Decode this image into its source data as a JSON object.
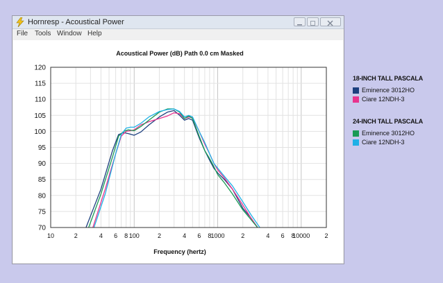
{
  "window": {
    "title": "Hornresp - Acoustical Power",
    "menu": [
      "File",
      "Tools",
      "Window",
      "Help"
    ]
  },
  "chart_data": {
    "type": "line",
    "title": "Acoustical Power (dB)   Path 0.0 cm   Masked",
    "xlabel": "Frequency (hertz)",
    "ylabel": "",
    "x_scale": "log",
    "xlim": [
      10,
      20000
    ],
    "ylim": [
      70,
      120
    ],
    "grid": true,
    "y_ticks": [
      70,
      75,
      80,
      85,
      90,
      95,
      100,
      105,
      110,
      115,
      120
    ],
    "x_tick_labels": [
      {
        "x": 10,
        "label": "10"
      },
      {
        "x": 20,
        "label": "2"
      },
      {
        "x": 40,
        "label": "4"
      },
      {
        "x": 60,
        "label": "6"
      },
      {
        "x": 80,
        "label": "8"
      },
      {
        "x": 100,
        "label": "100"
      },
      {
        "x": 200,
        "label": "2"
      },
      {
        "x": 400,
        "label": "4"
      },
      {
        "x": 600,
        "label": "6"
      },
      {
        "x": 800,
        "label": "8"
      },
      {
        "x": 1000,
        "label": "1000"
      },
      {
        "x": 2000,
        "label": "2"
      },
      {
        "x": 4000,
        "label": "4"
      },
      {
        "x": 6000,
        "label": "6"
      },
      {
        "x": 8000,
        "label": "8"
      },
      {
        "x": 10000,
        "label": "10000"
      },
      {
        "x": 20000,
        "label": "2"
      }
    ],
    "series": [
      {
        "name": "Eminence 3012HO",
        "group": "18-INCH TALL PASCALA",
        "color": "#1c3f7e",
        "x": [
          26.5,
          40,
          55,
          65,
          75,
          85,
          100,
          120,
          150,
          200,
          250,
          300,
          350,
          400,
          450,
          500,
          600,
          700,
          800,
          900,
          1000,
          1200,
          1500,
          2000,
          2500,
          3000
        ],
        "y": [
          70,
          82,
          94,
          99,
          99.6,
          99.3,
          98.8,
          99.8,
          102,
          104.5,
          106,
          106.5,
          105,
          103.5,
          104,
          103.5,
          98,
          94,
          91,
          88.5,
          87,
          85,
          82,
          76,
          73,
          70
        ]
      },
      {
        "name": "Ciare 12NDH-3",
        "group": "18-INCH TALL PASCALA",
        "color": "#e8338e",
        "x": [
          32,
          45,
          60,
          70,
          80,
          90,
          100,
          120,
          150,
          200,
          250,
          300,
          350,
          400,
          450,
          500,
          600,
          700,
          800,
          900,
          1000,
          1200,
          1500,
          2000,
          2500,
          3000
        ],
        "y": [
          70,
          82,
          93,
          98.5,
          100,
          100.2,
          100.5,
          102,
          103,
          104,
          104.8,
          105.8,
          105.5,
          104,
          104.5,
          104.2,
          100,
          96,
          93,
          90,
          88,
          85.5,
          82,
          77,
          73,
          70
        ]
      },
      {
        "name": "Eminence 3012HO",
        "group": "24-INCH TALL PASCALA",
        "color": "#1a9a55",
        "x": [
          28.5,
          40,
          55,
          65,
          75,
          85,
          100,
          120,
          150,
          200,
          250,
          300,
          350,
          400,
          450,
          500,
          600,
          700,
          800,
          900,
          1000,
          1200,
          1500,
          2000,
          2500,
          3000
        ],
        "y": [
          70,
          80.5,
          92,
          98.5,
          100,
          100.5,
          100.2,
          101.5,
          103.5,
          106,
          107,
          107,
          106,
          104,
          104.8,
          104,
          98.5,
          94,
          91.5,
          89,
          86.5,
          84,
          80.5,
          75.5,
          72.5,
          70
        ]
      },
      {
        "name": "Ciare 12NDH-3",
        "group": "24-INCH TALL PASCALA",
        "color": "#1fb0e6",
        "x": [
          33,
          45,
          60,
          70,
          80,
          90,
          100,
          120,
          150,
          200,
          250,
          300,
          350,
          400,
          450,
          500,
          600,
          700,
          800,
          900,
          1000,
          1200,
          1500,
          2000,
          2500,
          3000,
          3200
        ],
        "y": [
          70,
          80.5,
          93,
          99,
          101,
          101.3,
          101.3,
          102.5,
          104.5,
          106.2,
          106.8,
          107,
          106.2,
          104.5,
          105,
          104.5,
          100,
          96.5,
          93,
          90,
          88.5,
          86,
          83,
          78,
          74,
          71,
          70
        ]
      }
    ]
  },
  "legend": {
    "groups": [
      {
        "title": "18-INCH TALL PASCALA",
        "entries": [
          {
            "label": "Eminence 3012HO",
            "color": "#1c3f7e"
          },
          {
            "label": "Ciare 12NDH-3",
            "color": "#e8338e"
          }
        ]
      },
      {
        "title": "24-INCH TALL PASCALA",
        "entries": [
          {
            "label": "Eminence 3012HO",
            "color": "#1a9a55"
          },
          {
            "label": "Ciare 12NDH-3",
            "color": "#1fb0e6"
          }
        ]
      }
    ]
  }
}
